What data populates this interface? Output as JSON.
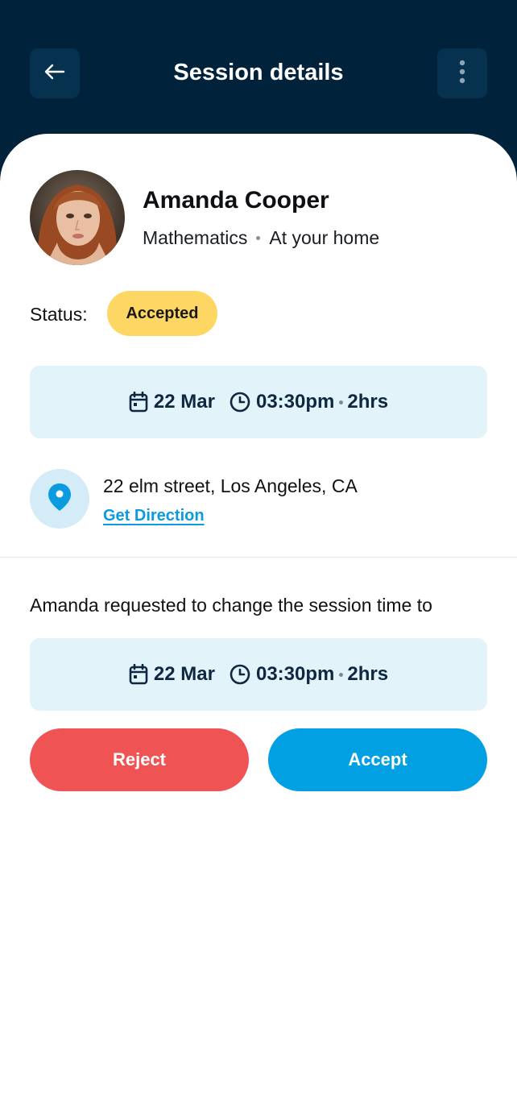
{
  "header": {
    "title": "Session details",
    "back_icon": "arrow-left-icon",
    "more_icon": "more-vertical-icon"
  },
  "profile": {
    "name": "Amanda Cooper",
    "subject": "Mathematics",
    "location_type": "At your home"
  },
  "status": {
    "label": "Status:",
    "value": "Accepted",
    "color": "#fdd663"
  },
  "session": {
    "date": "22 Mar",
    "time": "03:30pm",
    "duration": "2hrs"
  },
  "location": {
    "address": "22 elm street, Los Angeles, CA",
    "direction_link": "Get Direction",
    "icon": "map-pin-icon"
  },
  "request": {
    "text": "Amanda requested to change the session time to",
    "date": "22 Mar",
    "time": "03:30pm",
    "duration": "2hrs"
  },
  "actions": {
    "reject_label": "Reject",
    "accept_label": "Accept",
    "reject_color": "#f05353",
    "accept_color": "#00a0e3"
  },
  "colors": {
    "header_bg": "#00233b",
    "accent": "#0a9be0",
    "info_box_bg": "#e2f3fa"
  }
}
